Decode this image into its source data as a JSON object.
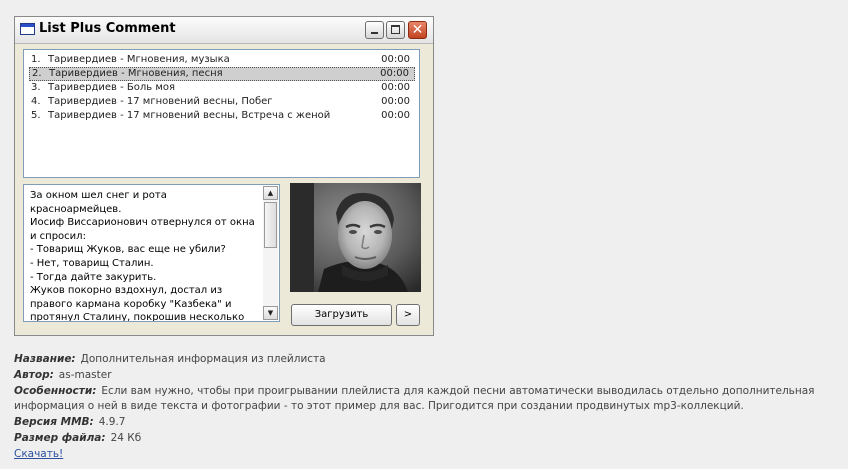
{
  "window": {
    "title": "List Plus Comment",
    "buttons": {
      "close_glyph": "✕"
    }
  },
  "playlist": {
    "tracks": [
      {
        "num": "1.",
        "name": "Таривердиев - Мгновения, музыка",
        "duration": "00:00",
        "selected": false
      },
      {
        "num": "2.",
        "name": "Таривердиев - Мгновения, песня",
        "duration": "00:00",
        "selected": true
      },
      {
        "num": "3.",
        "name": "Таривердиев - Боль моя",
        "duration": "00:00",
        "selected": false
      },
      {
        "num": "4.",
        "name": "Таривердиев - 17 мгновений весны, Побег",
        "duration": "00:00",
        "selected": false
      },
      {
        "num": "5.",
        "name": "Таривердиев - 17 мгновений весны, Встреча с женой",
        "duration": "00:00",
        "selected": false
      }
    ]
  },
  "comment": {
    "text": "За окном шел снег и рота красноармейцев.\nИосиф Виссарионович отвернулся от окна и спросил:\n- Товарищ Жуков, вас еще не убили?\n- Нет, товарищ Сталин.\n- Тогда дайте закурить.\nЖуков покорно вздохнул, достал из правого кармана коробку \"Казбека\" и протянул Сталину, покрошив несколько папирос в трубку, главнокомандующий",
    "scroll_up": "▲",
    "scroll_down": "▼"
  },
  "buttons": {
    "load_label": "Загрузить",
    "next_label": ">"
  },
  "info": {
    "name_label": "Название:",
    "name_value": "Дополнительная информация из плейлиста",
    "author_label": "Автор:",
    "author_value": "as-master",
    "features_label": "Особенности:",
    "features_value": "Если вам нужно, чтобы при проигрывании плейлиста для каждой песни автоматически выводилась отдельно дополнительная информация о ней в виде текста и фотографии - то этот пример для вас. Пригодится при создании продвинутых mp3-коллекций.",
    "version_label": "Версия MMB:",
    "version_value": "4.9.7",
    "size_label": "Размер файла:",
    "size_value": "24 Кб",
    "download_label": "Скачать!"
  }
}
